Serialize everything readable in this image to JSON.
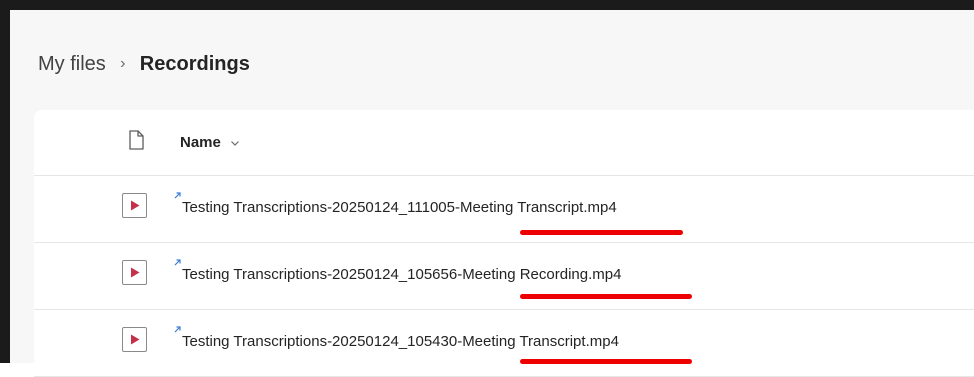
{
  "breadcrumb": {
    "root": "My files",
    "separator": "›",
    "current": "Recordings"
  },
  "list": {
    "name_header": "Name",
    "header_icon": "document-icon",
    "sort_icon": "chevron-down-icon",
    "files": [
      {
        "name": "Testing Transcriptions-20250124_111005-Meeting Transcript.mp4",
        "icon": "video-file-icon",
        "shared_icon": "shared-arrow-icon"
      },
      {
        "name": "Testing Transcriptions-20250124_105656-Meeting Recording.mp4",
        "icon": "video-file-icon",
        "shared_icon": "shared-arrow-icon"
      },
      {
        "name": "Testing Transcriptions-20250124_105430-Meeting Transcript.mp4",
        "icon": "video-file-icon",
        "shared_icon": "shared-arrow-icon"
      }
    ]
  },
  "colors": {
    "annotation_underline": "#ef0000",
    "play_icon": "#c4314b",
    "text": "#242424"
  }
}
